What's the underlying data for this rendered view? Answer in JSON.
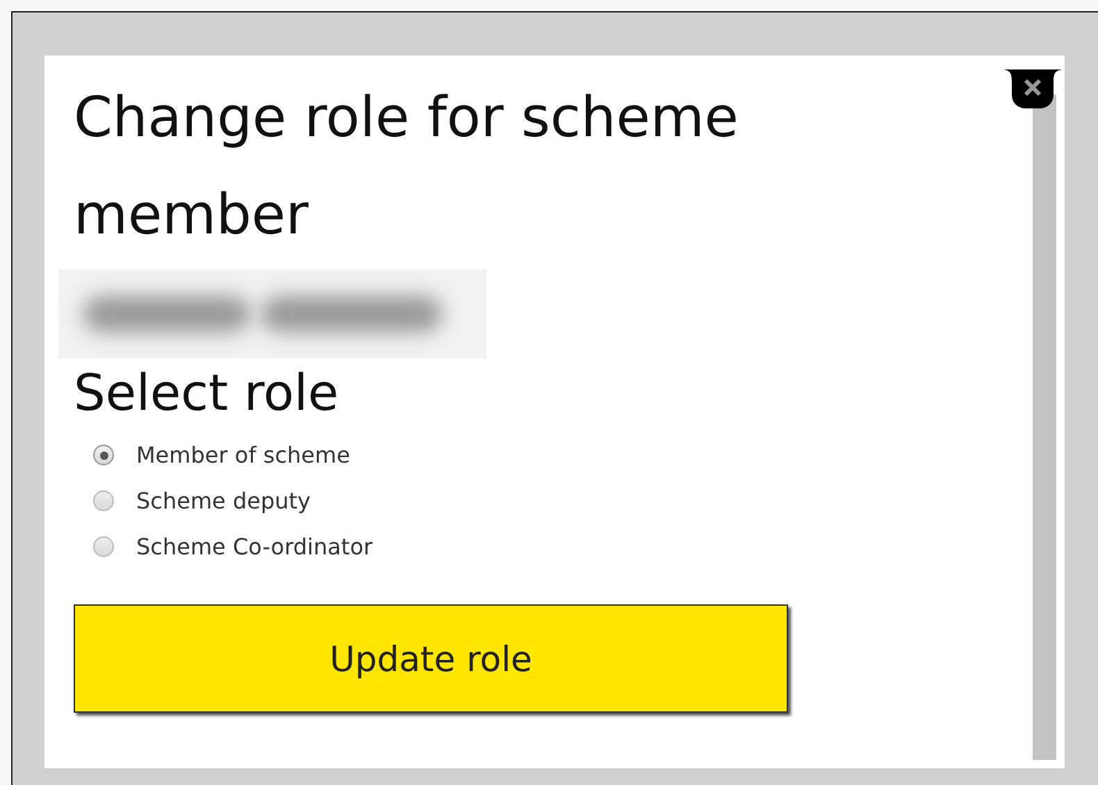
{
  "dialog": {
    "title": "Change role for scheme member",
    "subtitle": "Select role",
    "roles": [
      {
        "label": "Member of scheme",
        "selected": true
      },
      {
        "label": "Scheme deputy",
        "selected": false
      },
      {
        "label": "Scheme Co-ordinator",
        "selected": false
      }
    ],
    "button": "Update role"
  }
}
